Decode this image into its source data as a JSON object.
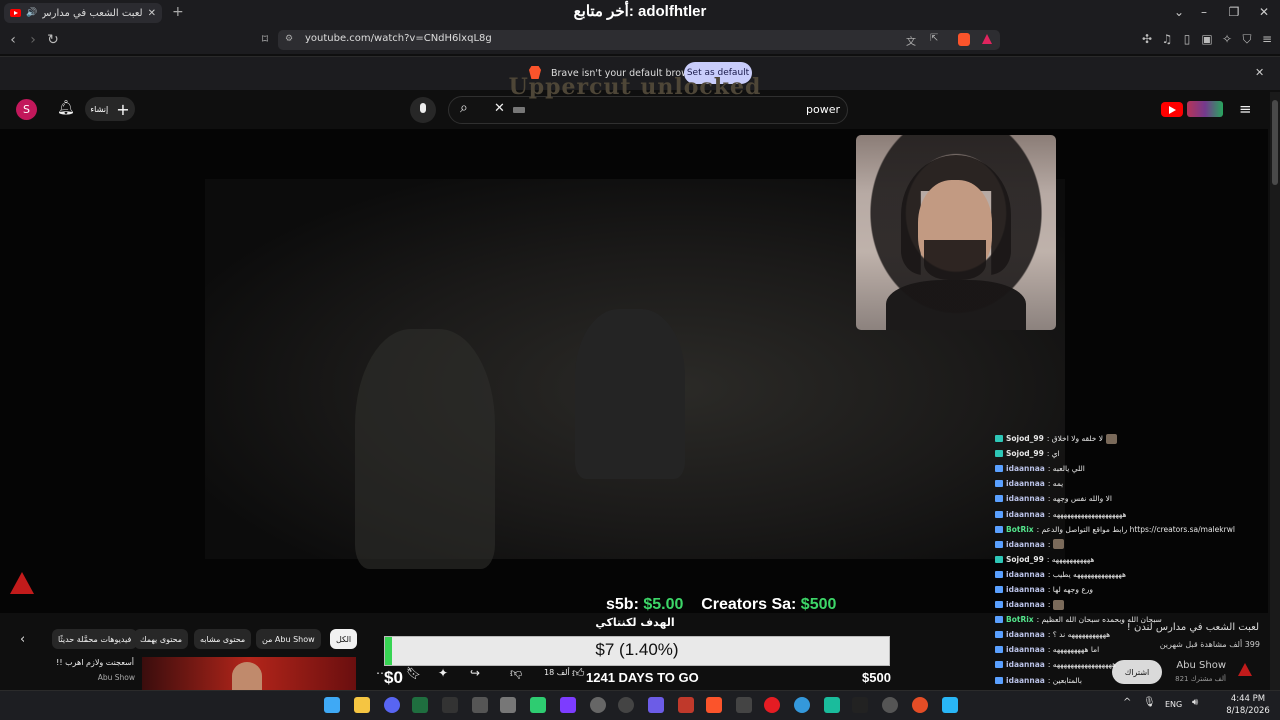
{
  "browser": {
    "tab_title": "لعبت الشعب في مدارس لندن !",
    "window_title": "أخر متابع: adolfhtler",
    "url": "youtube.com/watch?v=CNdH6lxqL8g",
    "notification_text": "Brave isn't your default browser",
    "notification_button": "Set as default"
  },
  "youtube_header": {
    "avatar_letter": "S",
    "create_label": "إنشاء",
    "search_value": "power",
    "colors": {
      "brand_red": "#ff0000",
      "avatar": "#c2185b"
    }
  },
  "video": {
    "game_caption": "Uppercut unlocked",
    "donors": [
      {
        "name": "s5b:",
        "amount": "$5.00"
      },
      {
        "name": "Creators Sa:",
        "amount": "$500"
      }
    ],
    "goal": {
      "title": "الهدف لكنتاكي",
      "progress_text": "$7 (1.40%)",
      "progress_fraction": 0.014,
      "start_label": "$0",
      "days_left": "1241 DAYS TO GO",
      "target_label": "$500"
    }
  },
  "chat": [
    {
      "user": "Sojod_99",
      "msg": ": لا خلقه ولا اخلاق",
      "type": "sj",
      "emote": true
    },
    {
      "user": "Sojod_99",
      "msg": ": اي",
      "type": "sj"
    },
    {
      "user": "idaannaa",
      "msg": ": اللي يالعبه",
      "type": "ida"
    },
    {
      "user": "idaannaa",
      "msg": ": يمه",
      "type": "ida"
    },
    {
      "user": "idaannaa",
      "msg": ": الا والله نفس وجهه",
      "type": "ida"
    },
    {
      "user": "idaannaa",
      "msg": ": ههههههههههههههههههههه",
      "type": "ida"
    },
    {
      "user": "BotRix",
      "msg": ": رابط مواقع التواصل والدعم https://creators.sa/malekrwl",
      "type": "bot"
    },
    {
      "user": "idaannaa",
      "msg": ":",
      "type": "ida",
      "emote": true
    },
    {
      "user": "Sojod_99",
      "msg": ": هههههههههههه",
      "type": "sj"
    },
    {
      "user": "idaannaa",
      "msg": ": ههههههههههههههه يطيب",
      "type": "ida"
    },
    {
      "user": "idaannaa",
      "msg": ": ورع وجهه لها",
      "type": "ida"
    },
    {
      "user": "idaannaa",
      "msg": ":",
      "type": "ida",
      "emote": true
    },
    {
      "user": "BotRix",
      "msg": ": سبحان الله وبحمده سبحان الله العظيم",
      "type": "bot"
    },
    {
      "user": "idaannaa",
      "msg": ": هههههههههههه ند ؟",
      "type": "ida"
    },
    {
      "user": "idaannaa",
      "msg": ": اما هههههههههه",
      "type": "ida"
    },
    {
      "user": "idaannaa",
      "msg": ": هههههههههههههههههه",
      "type": "ida"
    },
    {
      "user": "idaannaa",
      "msg": ": بالمتابعين",
      "type": "ida"
    }
  ],
  "player": {
    "chips": [
      "الكل",
      "من Abu Show",
      "محتوى مشابه",
      "محتوى يهمك",
      "فيديوهات محمَّلة حديثًا"
    ],
    "recommended_title": "أسعجنت ولازم اهرب !!",
    "recommended_channel": "Abu Show",
    "likes_count": "18 ألف",
    "video_title": "لعبت الشعب في مدارس لندن !",
    "views": "399 ألف مشاهدة  قبل شهرين",
    "subscribe_label": "اشتراك",
    "channel_name": "Abu Show",
    "channel_subs": "821 ألف مشترك"
  },
  "taskbar": {
    "language": "ENG",
    "time": "4:44 PM",
    "date": "8/18/2026"
  }
}
